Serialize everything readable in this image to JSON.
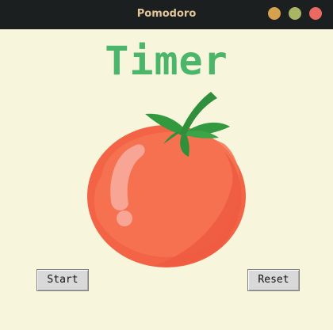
{
  "window": {
    "title": "Pomodoro",
    "controls": {
      "minimize_color": "#d6a14e",
      "maximize_color": "#a9b565",
      "close_color": "#ea6962"
    }
  },
  "main": {
    "title": "Timer",
    "title_color": "#4bb569",
    "image": "tomato-image"
  },
  "buttons": {
    "start_label": "Start",
    "reset_label": "Reset"
  }
}
